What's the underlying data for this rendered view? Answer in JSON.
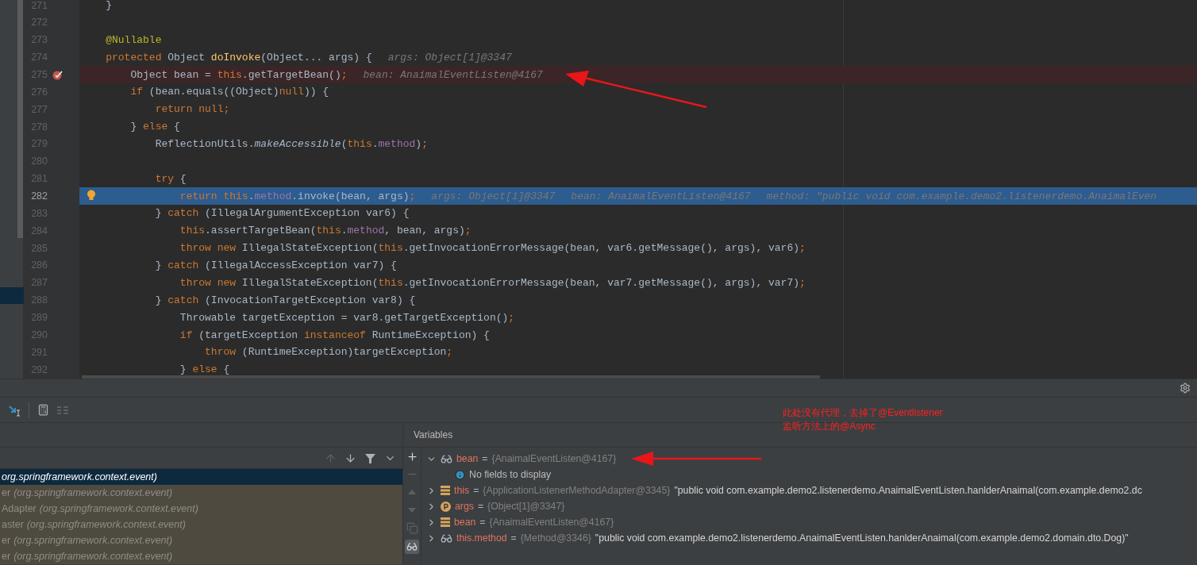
{
  "editor": {
    "lines": [
      {
        "number": "271",
        "kind": "normal",
        "segments": [
          {
            "kind": "plain",
            "text": "    }"
          }
        ]
      },
      {
        "number": "272",
        "kind": "normal"
      },
      {
        "number": "273",
        "kind": "normal",
        "segments": [
          {
            "kind": "ann",
            "text": "    @Nullable"
          }
        ]
      },
      {
        "number": "274",
        "kind": "normal",
        "segments": [
          {
            "kind": "kw",
            "text": "    protected"
          },
          {
            "kind": "plain",
            "text": " Object "
          },
          {
            "kind": "decl",
            "text": "doInvoke"
          },
          {
            "kind": "plain",
            "text": "(Object... args) {"
          },
          {
            "kind": "hint",
            "text": "args: Object[1]@3347"
          }
        ]
      },
      {
        "number": "275",
        "kind": "breakpoint",
        "segments": [
          {
            "kind": "plain",
            "text": "        Object bean = "
          },
          {
            "kind": "kw",
            "text": "this"
          },
          {
            "kind": "plain",
            "text": ".getTargetBean()"
          },
          {
            "kind": "kw",
            "text": ";"
          },
          {
            "kind": "hint",
            "text": "bean: AnaimalEventListen@4167"
          }
        ]
      },
      {
        "number": "276",
        "kind": "normal",
        "segments": [
          {
            "kind": "kw",
            "text": "        if"
          },
          {
            "kind": "plain",
            "text": " (bean.equals((Object)"
          },
          {
            "kind": "kw",
            "text": "null"
          },
          {
            "kind": "plain",
            "text": ")) {"
          }
        ]
      },
      {
        "number": "277",
        "kind": "normal",
        "segments": [
          {
            "kind": "kw",
            "text": "            return null;"
          }
        ]
      },
      {
        "number": "278",
        "kind": "normal",
        "segments": [
          {
            "kind": "plain",
            "text": "        } "
          },
          {
            "kind": "kw",
            "text": "else"
          },
          {
            "kind": "plain",
            "text": " {"
          }
        ]
      },
      {
        "number": "279",
        "kind": "normal",
        "segments": [
          {
            "kind": "plain",
            "text": "            ReflectionUtils."
          },
          {
            "kind": "italic",
            "text": "makeAccessible"
          },
          {
            "kind": "plain",
            "text": "("
          },
          {
            "kind": "kw",
            "text": "this"
          },
          {
            "kind": "plain",
            "text": "."
          },
          {
            "kind": "field",
            "text": "method"
          },
          {
            "kind": "plain",
            "text": ")"
          },
          {
            "kind": "kw",
            "text": ";"
          }
        ]
      },
      {
        "number": "280",
        "kind": "normal"
      },
      {
        "number": "281",
        "kind": "normal",
        "segments": [
          {
            "kind": "kw",
            "text": "            try"
          },
          {
            "kind": "plain",
            "text": " {"
          }
        ]
      },
      {
        "number": "282",
        "kind": "execution",
        "segments": [
          {
            "kind": "kw",
            "text": "                return this"
          },
          {
            "kind": "plain",
            "text": "."
          },
          {
            "kind": "field",
            "text": "method"
          },
          {
            "kind": "plain",
            "text": ".invoke(bean, args)"
          },
          {
            "kind": "kw",
            "text": ";"
          },
          {
            "kind": "hint",
            "text": "args: Object[1]@3347"
          },
          {
            "kind": "hint",
            "text": "bean: AnaimalEventListen@4167"
          },
          {
            "kind": "hint",
            "text": "method: \"public void com.example.demo2.listenerdemo.AnaimalEven"
          }
        ]
      },
      {
        "number": "283",
        "kind": "normal",
        "segments": [
          {
            "kind": "plain",
            "text": "            } "
          },
          {
            "kind": "kw",
            "text": "catch"
          },
          {
            "kind": "plain",
            "text": " (IllegalArgumentException var6) {"
          }
        ]
      },
      {
        "number": "284",
        "kind": "normal",
        "segments": [
          {
            "kind": "kw",
            "text": "                this"
          },
          {
            "kind": "plain",
            "text": ".assertTargetBean("
          },
          {
            "kind": "kw",
            "text": "this"
          },
          {
            "kind": "plain",
            "text": "."
          },
          {
            "kind": "field",
            "text": "method"
          },
          {
            "kind": "plain",
            "text": ", bean, args)"
          },
          {
            "kind": "kw",
            "text": ";"
          }
        ]
      },
      {
        "number": "285",
        "kind": "normal",
        "segments": [
          {
            "kind": "kw",
            "text": "                throw new"
          },
          {
            "kind": "plain",
            "text": " IllegalStateException("
          },
          {
            "kind": "kw",
            "text": "this"
          },
          {
            "kind": "plain",
            "text": ".getInvocationErrorMessage(bean, var6.getMessage(), args), var6)"
          },
          {
            "kind": "kw",
            "text": ";"
          }
        ]
      },
      {
        "number": "286",
        "kind": "normal",
        "segments": [
          {
            "kind": "plain",
            "text": "            } "
          },
          {
            "kind": "kw",
            "text": "catch"
          },
          {
            "kind": "plain",
            "text": " (IllegalAccessException var7) {"
          }
        ]
      },
      {
        "number": "287",
        "kind": "normal",
        "segments": [
          {
            "kind": "kw",
            "text": "                throw new"
          },
          {
            "kind": "plain",
            "text": " IllegalStateException("
          },
          {
            "kind": "kw",
            "text": "this"
          },
          {
            "kind": "plain",
            "text": ".getInvocationErrorMessage(bean, var7.getMessage(), args), var7)"
          },
          {
            "kind": "kw",
            "text": ";"
          }
        ]
      },
      {
        "number": "288",
        "kind": "normal",
        "segments": [
          {
            "kind": "plain",
            "text": "            } "
          },
          {
            "kind": "kw",
            "text": "catch"
          },
          {
            "kind": "plain",
            "text": " (InvocationTargetException var8) {"
          }
        ]
      },
      {
        "number": "289",
        "kind": "normal",
        "segments": [
          {
            "kind": "plain",
            "text": "                Throwable targetException = var8.getTargetException()"
          },
          {
            "kind": "kw",
            "text": ";"
          }
        ]
      },
      {
        "number": "290",
        "kind": "normal",
        "segments": [
          {
            "kind": "kw",
            "text": "                if"
          },
          {
            "kind": "plain",
            "text": " (targetException "
          },
          {
            "kind": "kw",
            "text": "instanceof"
          },
          {
            "kind": "plain",
            "text": " RuntimeException) {"
          }
        ]
      },
      {
        "number": "291",
        "kind": "normal",
        "segments": [
          {
            "kind": "kw",
            "text": "                    throw"
          },
          {
            "kind": "plain",
            "text": " (RuntimeException)targetException"
          },
          {
            "kind": "kw",
            "text": ";"
          }
        ]
      },
      {
        "number": "292",
        "kind": "normal",
        "segments": [
          {
            "kind": "plain",
            "text": "                } "
          },
          {
            "kind": "kw",
            "text": "else"
          },
          {
            "kind": "plain",
            "text": " {"
          }
        ]
      }
    ]
  },
  "frames": {
    "tools": [
      {
        "kind": "up",
        "disabled": true
      },
      {
        "kind": "down",
        "disabled": false
      },
      {
        "kind": "filter",
        "disabled": false
      },
      {
        "kind": "dropdown",
        "disabled": false
      }
    ],
    "rows": [
      {
        "package": "org.springframework.context.event)",
        "selected": true
      },
      {
        "method": "er",
        "package": "(org.springframework.context.event)",
        "selected": false
      },
      {
        "method": "Adapter",
        "package": "(org.springframework.context.event)",
        "selected": false
      },
      {
        "method": "aster",
        "package": "(org.springframework.context.event)",
        "selected": false
      },
      {
        "method": "er",
        "package": "(org.springframework.context.event)",
        "selected": false
      },
      {
        "method": "er",
        "package": "(org.springframework.context.event)",
        "selected": false
      }
    ]
  },
  "variables": {
    "title": "Variables",
    "tools": [
      {
        "kind": "add",
        "disabled": false,
        "selected": false
      },
      {
        "kind": "remove",
        "disabled": true,
        "selected": false
      },
      {
        "kind": "up",
        "disabled": true,
        "selected": false
      },
      {
        "kind": "down",
        "disabled": true,
        "selected": false
      },
      {
        "kind": "copy",
        "disabled": true,
        "selected": false
      },
      {
        "kind": "watches",
        "disabled": false,
        "selected": true
      }
    ],
    "rows": [
      {
        "kind": "watch",
        "expanded": true,
        "name": "bean",
        "equals": "=",
        "value": "{AnaimalEventListen@4167}",
        "children": [
          {
            "kind": "info",
            "text": "No fields to display"
          }
        ]
      },
      {
        "kind": "field",
        "expanded": false,
        "name": "this",
        "equals": "=",
        "value": "{ApplicationListenerMethodAdapter@3345}",
        "description": "\"public void com.example.demo2.listenerdemo.AnaimalEventListen.hanlderAnaimal(com.example.demo2.dc"
      },
      {
        "kind": "parameter",
        "expanded": false,
        "name": "args",
        "equals": "=",
        "value": "{Object[1]@3347}"
      },
      {
        "kind": "field",
        "expanded": false,
        "name": "bean",
        "equals": "=",
        "value": "{AnaimalEventListen@4167}"
      },
      {
        "kind": "watch",
        "expanded": false,
        "name": "this.method",
        "equals": "=",
        "value": "{Method@3346}",
        "description": "\"public void com.example.demo2.listenerdemo.AnaimalEventListen.hanlderAnaimal(com.example.demo2.domain.dto.Dog)\""
      }
    ]
  },
  "annotation": {
    "lines": [
      "此处没有代理，去掉了@Eventlistener",
      "监听方法上的@Async"
    ]
  }
}
